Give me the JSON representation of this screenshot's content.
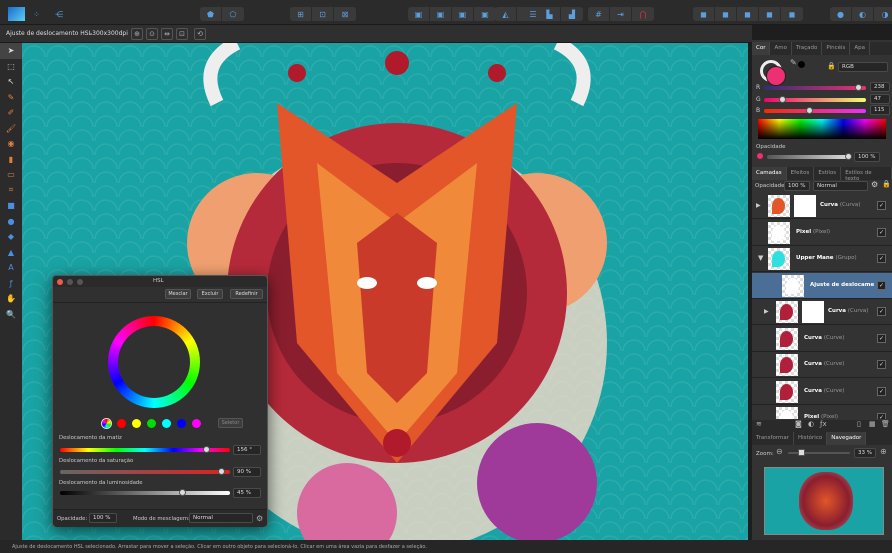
{
  "toolbar": {
    "groups": [
      {
        "icons": [
          "persona-photo-icon",
          "persona-pixel-icon",
          "share-icon"
        ]
      },
      {
        "icons": [
          "persona-liquify-icon",
          "persona-develop-icon"
        ]
      },
      {
        "icons": [
          "selection-all-icon",
          "selection-edge-icon",
          "selection-transform-icon"
        ]
      },
      {
        "icons": [
          "arrange-front-icon",
          "arrange-forward-icon",
          "arrange-backward-icon",
          "arrange-back-icon"
        ]
      },
      {
        "icons": [
          "flip-horizontal-icon",
          "flip-vertical-icon",
          "rotate-left-icon",
          "rotate-right-icon"
        ]
      },
      {
        "icons": [
          "align-icon"
        ]
      },
      {
        "icons": [
          "snap-grid-icon",
          "snap-guides-icon",
          "magnet-icon"
        ]
      },
      {
        "icons": [
          "boolean-add-icon",
          "boolean-subtract-icon",
          "boolean-intersect-icon",
          "boolean-xor-icon",
          "boolean-divide-icon"
        ]
      },
      {
        "icons": [
          "quick-mask-icon",
          "refine-icon",
          "mask-icon"
        ]
      }
    ]
  },
  "context": {
    "layer_label": "Ajuste de deslocamento HSL",
    "dpi": "-300x300dpi"
  },
  "color_panel": {
    "tabs": [
      "Cor",
      "Amo",
      "Traçado",
      "Pincéis",
      "Apa"
    ],
    "mode": "RGB",
    "r_label": "R",
    "g_label": "G",
    "b_label": "B",
    "r": "238",
    "g": "47",
    "b": "115",
    "r_val": 238,
    "g_val": 47,
    "b_val": 115,
    "opacity_label": "Opacidade",
    "opacity": "100 %",
    "color": "#ee2f73"
  },
  "layers_panel": {
    "tabs": [
      "Camadas",
      "Efeitos",
      "Estilos",
      "Estilos de texto"
    ],
    "opacity_label": "Opacidade:",
    "opacity": "100 %",
    "blend": "Normal",
    "layers": [
      {
        "name": "Curva",
        "type": "(Curva)"
      },
      {
        "name": "Pixel",
        "type": "(Pixel)"
      },
      {
        "name": "Upper Mane",
        "type": "(Grupo)"
      },
      {
        "name": "Ajuste de deslocame",
        "type": ""
      },
      {
        "name": "Curva",
        "type": "(Curva)"
      },
      {
        "name": "Curva",
        "type": "(Curve)"
      },
      {
        "name": "Curva",
        "type": "(Curve)"
      },
      {
        "name": "Curva",
        "type": "(Curve)"
      },
      {
        "name": "Pixel",
        "type": "(Pixel)"
      }
    ]
  },
  "navigator_panel": {
    "tabs": [
      "Transformar",
      "Histórico",
      "Navegador"
    ],
    "zoom_label": "Zoom:",
    "zoom": "33 %",
    "zoom_value": 33
  },
  "hsl_dialog": {
    "title": "HSL",
    "merge": "Mesclar",
    "delete": "Excluir",
    "reset": "Redefinir",
    "picker": "Seletor",
    "swatches": [
      "#ff0000",
      "#ffff00",
      "#00dd00",
      "#00ffff",
      "#0000ff",
      "#ff00ff"
    ],
    "hue_label": "Deslocamento da matiz",
    "hue": "156 °",
    "hue_value": 156,
    "sat_label": "Deslocamento da saturação",
    "sat": "90 %",
    "sat_value": 90,
    "lum_label": "Deslocamento da luminosidade",
    "lum": "45 %",
    "lum_value": 45,
    "opacity_label": "Opacidade:",
    "opacity": "100 %",
    "blend_label": "Modo de mesclagem:",
    "blend": "Normal"
  },
  "status": {
    "text": "Ajuste de deslocamento HSL selecionado. Arrastar para mover a seleção. Clicar em outro objeto para selecioná-lo. Clicar em uma área vazia para desfazer a seleção."
  }
}
